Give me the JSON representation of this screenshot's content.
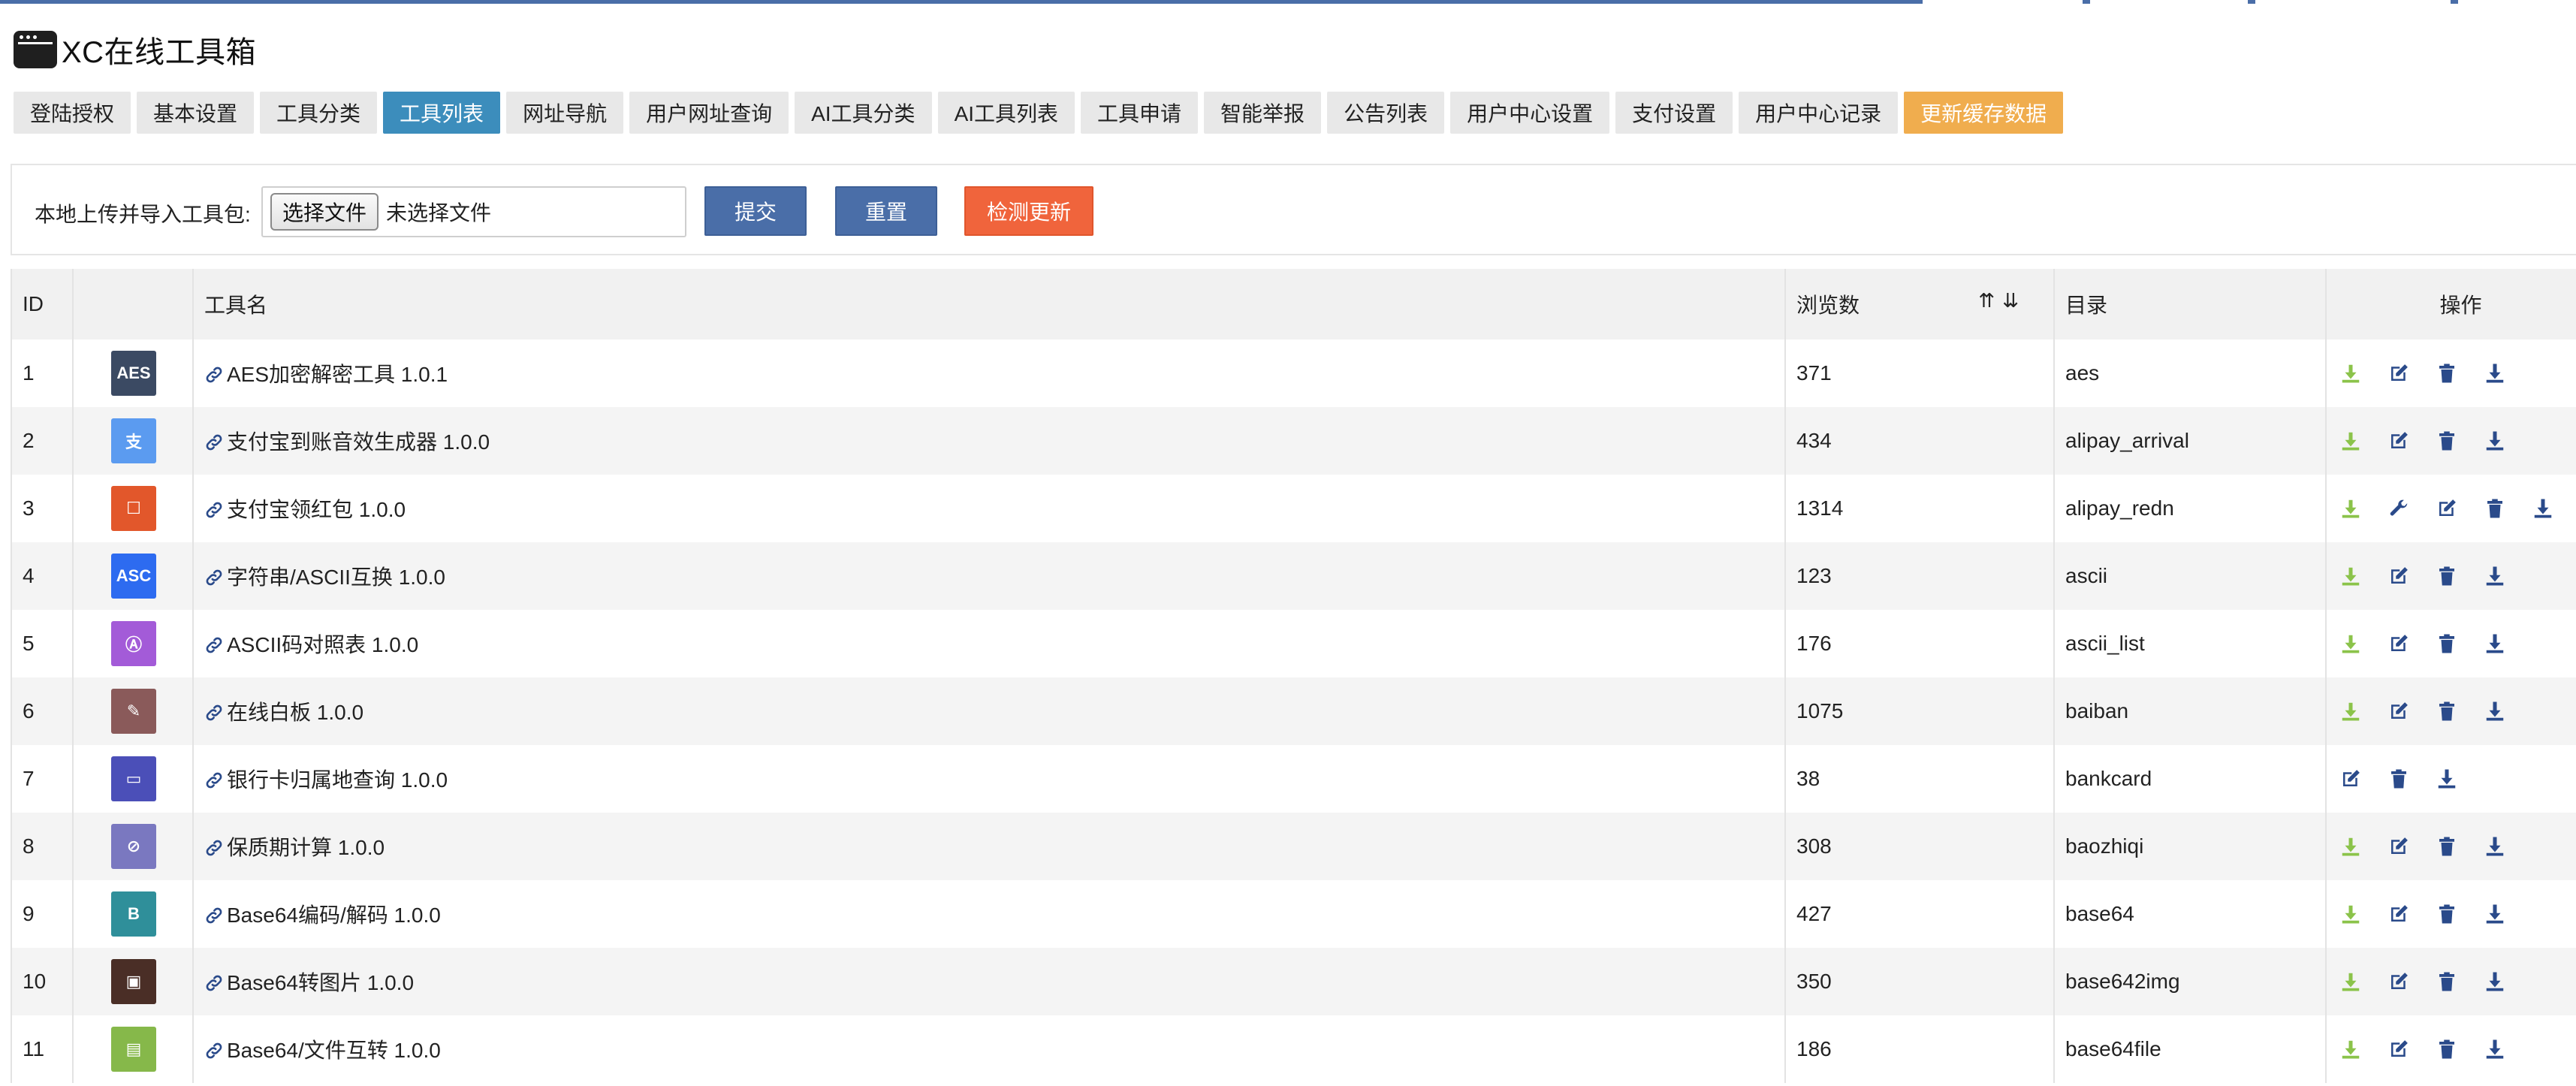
{
  "app": {
    "title": "XC在线工具箱",
    "icon": "app-window-icon"
  },
  "tabs": [
    {
      "label": "登陆授权",
      "state": "normal"
    },
    {
      "label": "基本设置",
      "state": "normal"
    },
    {
      "label": "工具分类",
      "state": "normal"
    },
    {
      "label": "工具列表",
      "state": "active"
    },
    {
      "label": "网址导航",
      "state": "normal"
    },
    {
      "label": "用户网址查询",
      "state": "normal"
    },
    {
      "label": "AI工具分类",
      "state": "normal"
    },
    {
      "label": "AI工具列表",
      "state": "normal"
    },
    {
      "label": "工具申请",
      "state": "normal"
    },
    {
      "label": "智能举报",
      "state": "normal"
    },
    {
      "label": "公告列表",
      "state": "normal"
    },
    {
      "label": "用户中心设置",
      "state": "normal"
    },
    {
      "label": "支付设置",
      "state": "normal"
    },
    {
      "label": "用户中心记录",
      "state": "normal"
    },
    {
      "label": "更新缓存数据",
      "state": "warning"
    }
  ],
  "upload": {
    "label": "本地上传并导入工具包:",
    "file_button": "选择文件",
    "file_status": "未选择文件",
    "submit": "提交",
    "reset": "重置",
    "check_update": "检测更新"
  },
  "table": {
    "headers": {
      "id": "ID",
      "icon": "",
      "name": "工具名",
      "views": "浏览数",
      "sort_asc": "⇈",
      "sort_desc": "⇊",
      "dir": "目录",
      "ops": "操作"
    },
    "rows": [
      {
        "id": "1",
        "thumb_text": "AES",
        "thumb_color": "#3b4a63",
        "name": "AES加密解密工具 1.0.1",
        "views": "371",
        "dir": "aes",
        "ops": [
          "install",
          "edit",
          "delete",
          "download"
        ]
      },
      {
        "id": "2",
        "thumb_text": "支",
        "thumb_color": "#5b9bf0",
        "name": "支付宝到账音效生成器 1.0.0",
        "views": "434",
        "dir": "alipay_arrival",
        "ops": [
          "install",
          "edit",
          "delete",
          "download"
        ]
      },
      {
        "id": "3",
        "thumb_text": "☐",
        "thumb_color": "#e2572b",
        "name": "支付宝领红包 1.0.0",
        "views": "1314",
        "dir": "alipay_redn",
        "ops": [
          "install",
          "settings",
          "edit",
          "delete",
          "download"
        ]
      },
      {
        "id": "4",
        "thumb_text": "ASC",
        "thumb_color": "#2d6bf0",
        "name": "字符串/ASCII互换 1.0.0",
        "views": "123",
        "dir": "ascii",
        "ops": [
          "install",
          "edit",
          "delete",
          "download"
        ]
      },
      {
        "id": "5",
        "thumb_text": "Ⓐ",
        "thumb_color": "#a35bd8",
        "name": "ASCII码对照表 1.0.0",
        "views": "176",
        "dir": "ascii_list",
        "ops": [
          "install",
          "edit",
          "delete",
          "download"
        ]
      },
      {
        "id": "6",
        "thumb_text": "✎",
        "thumb_color": "#8a5a5a",
        "name": "在线白板 1.0.0",
        "views": "1075",
        "dir": "baiban",
        "ops": [
          "install",
          "edit",
          "delete",
          "download"
        ]
      },
      {
        "id": "7",
        "thumb_text": "▭",
        "thumb_color": "#4b4fb8",
        "name": "银行卡归属地查询 1.0.0",
        "views": "38",
        "dir": "bankcard",
        "ops": [
          "edit",
          "delete",
          "download"
        ]
      },
      {
        "id": "8",
        "thumb_text": "⊘",
        "thumb_color": "#7a78c0",
        "name": "保质期计算 1.0.0",
        "views": "308",
        "dir": "baozhiqi",
        "ops": [
          "install",
          "edit",
          "delete",
          "download"
        ]
      },
      {
        "id": "9",
        "thumb_text": "B",
        "thumb_color": "#2f8f9a",
        "name": "Base64编码/解码 1.0.0",
        "views": "427",
        "dir": "base64",
        "ops": [
          "install",
          "edit",
          "delete",
          "download"
        ]
      },
      {
        "id": "10",
        "thumb_text": "▣",
        "thumb_color": "#4a2e26",
        "name": "Base64转图片 1.0.0",
        "views": "350",
        "dir": "base642img",
        "ops": [
          "install",
          "edit",
          "delete",
          "download"
        ]
      },
      {
        "id": "11",
        "thumb_text": "▤",
        "thumb_color": "#86b84a",
        "name": "Base64/文件互转 1.0.0",
        "views": "186",
        "dir": "base64file",
        "ops": [
          "install",
          "edit",
          "delete",
          "download"
        ]
      }
    ]
  },
  "colors": {
    "primary": "#4a6ea8",
    "active_tab": "#3c8dbc",
    "warning": "#f0ad4e",
    "danger": "#f0643c",
    "install_icon": "#8bc34a",
    "action_icon": "#2a4a8a"
  }
}
